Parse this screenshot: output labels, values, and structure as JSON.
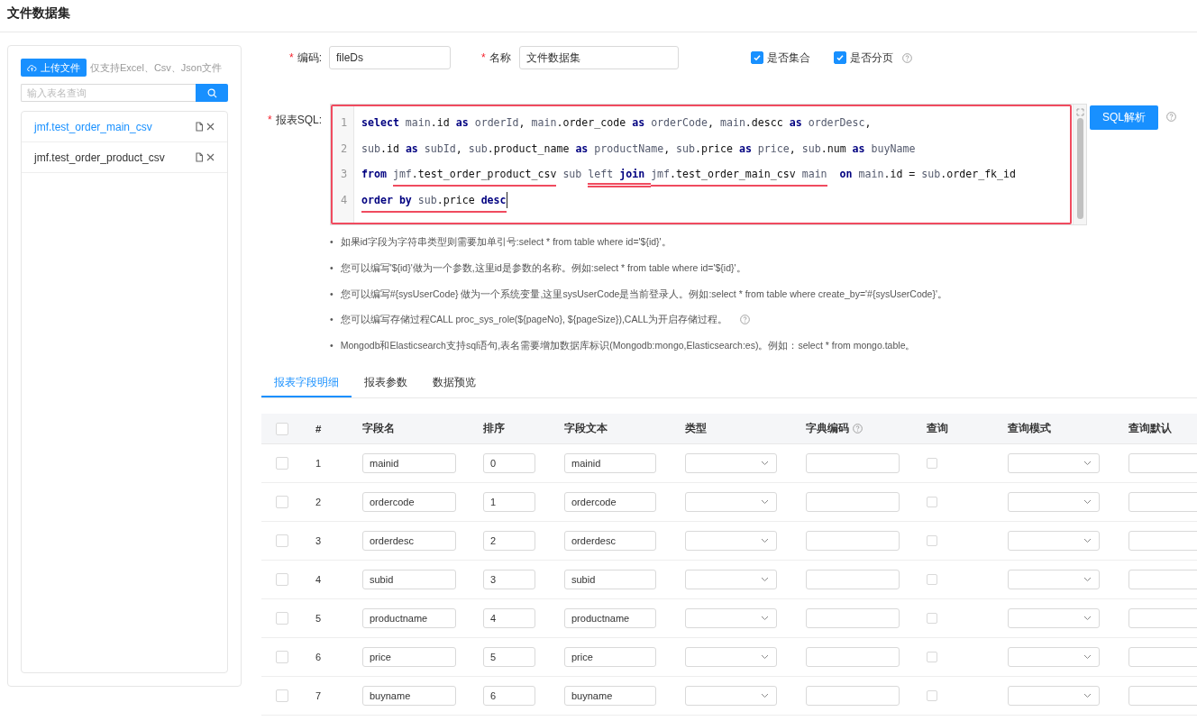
{
  "page_title": "文件数据集",
  "sidebar": {
    "upload_button": "上传文件",
    "upload_hint": "仅支持Excel、Csv、Json文件",
    "search": {
      "placeholder": "输入表名查询"
    },
    "items": [
      {
        "label": "jmf.test_order_main_csv",
        "selected": true
      },
      {
        "label": "jmf.test_order_product_csv",
        "selected": false
      }
    ]
  },
  "form": {
    "code": {
      "required_mark": "*",
      "label": "编码:",
      "value": "fileDs"
    },
    "name": {
      "required_mark": "*",
      "label": "名称",
      "value": "文件数据集"
    },
    "checkboxes": [
      {
        "label": "是否集合",
        "checked": true,
        "help": false
      },
      {
        "label": "是否分页",
        "checked": true,
        "help": true
      }
    ],
    "sql_required_mark": "*",
    "sql_label": "报表SQL:",
    "sql_button": "SQL解析",
    "sql_lines": [
      {
        "number": "1",
        "cursor": false,
        "tokens": [
          {
            "kind": "kw",
            "text": "select"
          },
          {
            "kind": "var",
            "text": " main"
          },
          {
            "kind": "plain",
            "text": ".id "
          },
          {
            "kind": "kw",
            "text": "as"
          },
          {
            "kind": "var",
            "text": " orderId"
          },
          {
            "kind": "plain",
            "text": ", "
          },
          {
            "kind": "var",
            "text": "main"
          },
          {
            "kind": "plain",
            "text": ".order_code "
          },
          {
            "kind": "kw",
            "text": "as"
          },
          {
            "kind": "var",
            "text": " orderCode"
          },
          {
            "kind": "plain",
            "text": ", "
          },
          {
            "kind": "var",
            "text": "main"
          },
          {
            "kind": "plain",
            "text": ".descc "
          },
          {
            "kind": "kw",
            "text": "as"
          },
          {
            "kind": "var",
            "text": " orderDesc"
          },
          {
            "kind": "plain",
            "text": ","
          }
        ]
      },
      {
        "number": "2",
        "cursor": false,
        "tokens": [
          {
            "kind": "var",
            "text": "sub"
          },
          {
            "kind": "plain",
            "text": ".id "
          },
          {
            "kind": "kw",
            "text": "as"
          },
          {
            "kind": "var",
            "text": " subId"
          },
          {
            "kind": "plain",
            "text": ", "
          },
          {
            "kind": "var",
            "text": "sub"
          },
          {
            "kind": "plain",
            "text": ".product_name "
          },
          {
            "kind": "kw",
            "text": "as"
          },
          {
            "kind": "var",
            "text": " productName"
          },
          {
            "kind": "plain",
            "text": ", "
          },
          {
            "kind": "var",
            "text": "sub"
          },
          {
            "kind": "plain",
            "text": ".price "
          },
          {
            "kind": "kw",
            "text": "as"
          },
          {
            "kind": "var",
            "text": " price"
          },
          {
            "kind": "plain",
            "text": ", "
          },
          {
            "kind": "var",
            "text": "sub"
          },
          {
            "kind": "plain",
            "text": ".num "
          },
          {
            "kind": "kw",
            "text": "as"
          },
          {
            "kind": "var",
            "text": " buyName"
          }
        ]
      },
      {
        "number": "3",
        "cursor": false,
        "tokens": [
          {
            "kind": "kw",
            "text": "from "
          },
          {
            "kind": "var",
            "text": "jmf",
            "underlined": true,
            "double": false
          },
          {
            "kind": "plain",
            "text": ".test_order_product_csv",
            "underlined": true,
            "double": false
          },
          {
            "kind": "var",
            "text": " sub "
          },
          {
            "kind": "var",
            "text": "left ",
            "underlined": true,
            "double": true
          },
          {
            "kind": "kw",
            "text": "join ",
            "underlined": true,
            "double": true
          },
          {
            "kind": "var",
            "text": "jmf",
            "underlined": true,
            "double": false
          },
          {
            "kind": "plain",
            "text": ".test_order_main_csv",
            "underlined": true,
            "double": false
          },
          {
            "kind": "var",
            "text": " main",
            "underlined": true,
            "double": false
          },
          {
            "kind": "kw",
            "text": "  on"
          },
          {
            "kind": "var",
            "text": " main"
          },
          {
            "kind": "plain",
            "text": ".id = "
          },
          {
            "kind": "var",
            "text": "sub"
          },
          {
            "kind": "plain",
            "text": ".order_fk_id"
          }
        ]
      },
      {
        "number": "4",
        "cursor": true,
        "tokens": [
          {
            "kind": "kw",
            "text": "order by",
            "underlined": true,
            "double": false
          },
          {
            "kind": "var",
            "text": " sub",
            "underlined": true,
            "double": false
          },
          {
            "kind": "plain",
            "text": ".price ",
            "underlined": true,
            "double": false
          },
          {
            "kind": "kw",
            "text": "desc",
            "underlined": true,
            "double": false
          }
        ]
      }
    ],
    "tips": [
      {
        "marker": "•",
        "text": "如果id字段为字符串类型则需要加单引号:select * from table where id='${id}'。",
        "help": false
      },
      {
        "marker": "•",
        "text": "您可以编写'${id}'做为一个参数,这里id是参数的名称。例如:select * from table where id='${id}'。",
        "help": false
      },
      {
        "marker": "•",
        "text": "您可以编写#{sysUserCode} 做为一个系统变量,这里sysUserCode是当前登录人。例如:select * from table where create_by='#{sysUserCode}'。",
        "help": false
      },
      {
        "marker": "•",
        "text": "您可以编写存储过程CALL proc_sys_role(${pageNo}, ${pageSize}),CALL为开启存储过程。",
        "help": true
      },
      {
        "marker": "•",
        "text": "Mongodb和Elasticsearch支持sql语句,表名需要增加数据库标识(Mongodb:mongo,Elasticsearch:es)。例如：select * from mongo.table。",
        "help": false
      }
    ]
  },
  "tabs": [
    {
      "label": "报表字段明细",
      "selected": true
    },
    {
      "label": "报表参数",
      "selected": false
    },
    {
      "label": "数据预览",
      "selected": false
    }
  ],
  "table": {
    "all_checked": false,
    "columns": [
      {
        "kind": "check"
      },
      {
        "kind": "text",
        "label": "#"
      },
      {
        "kind": "input",
        "label": "字段名"
      },
      {
        "kind": "small",
        "label": "排序"
      },
      {
        "kind": "input",
        "label": "字段文本"
      },
      {
        "kind": "select",
        "label": "类型"
      },
      {
        "kind": "input",
        "label": "字典编码",
        "help": true
      },
      {
        "kind": "check",
        "label": "查询"
      },
      {
        "kind": "select",
        "label": "查询模式"
      },
      {
        "kind": "input",
        "label": "查询默认"
      }
    ],
    "rows": [
      {
        "checked": false,
        "number": "1",
        "field": "mainid",
        "order": "0",
        "text": "mainid",
        "query": false
      },
      {
        "checked": false,
        "number": "2",
        "field": "ordercode",
        "order": "1",
        "text": "ordercode",
        "query": false
      },
      {
        "checked": false,
        "number": "3",
        "field": "orderdesc",
        "order": "2",
        "text": "orderdesc",
        "query": false
      },
      {
        "checked": false,
        "number": "4",
        "field": "subid",
        "order": "3",
        "text": "subid",
        "query": false
      },
      {
        "checked": false,
        "number": "5",
        "field": "productname",
        "order": "4",
        "text": "productname",
        "query": false
      },
      {
        "checked": false,
        "number": "6",
        "field": "price",
        "order": "5",
        "text": "price",
        "query": false
      },
      {
        "checked": false,
        "number": "7",
        "field": "buyname",
        "order": "6",
        "text": "buyname",
        "query": false
      }
    ]
  }
}
